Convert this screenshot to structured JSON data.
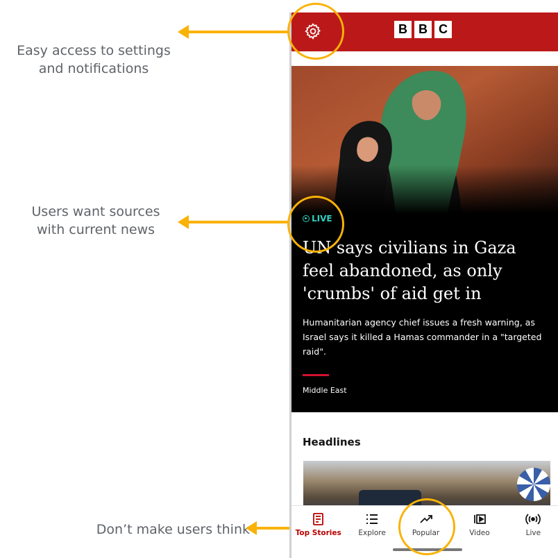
{
  "annotations": {
    "settings": "Easy access to settings\nand notifications",
    "live": "Users want sources\nwith current news",
    "think": "Don’t make users think"
  },
  "app": {
    "logo_letters": [
      "B",
      "B",
      "C"
    ],
    "brand_color": "#bb1919",
    "accent_color": "#f9b208",
    "settings_icon": "gear-icon"
  },
  "lead_story": {
    "badge": "LIVE",
    "headline": "UN says civilians in Gaza feel abandoned, as only 'crumbs' of aid get in",
    "summary": "Humanitarian agency chief issues a fresh warning, as Israel says it killed a Hamas commander in a \"targeted raid\".",
    "section": "Middle East"
  },
  "headlines": {
    "title": "Headlines"
  },
  "tabs": [
    {
      "label": "Top Stories",
      "icon": "news-icon",
      "active": true
    },
    {
      "label": "Explore",
      "icon": "list-icon",
      "active": false
    },
    {
      "label": "Popular",
      "icon": "trending-icon",
      "active": false
    },
    {
      "label": "Video",
      "icon": "video-icon",
      "active": false
    },
    {
      "label": "Live",
      "icon": "broadcast-icon",
      "active": false
    }
  ]
}
